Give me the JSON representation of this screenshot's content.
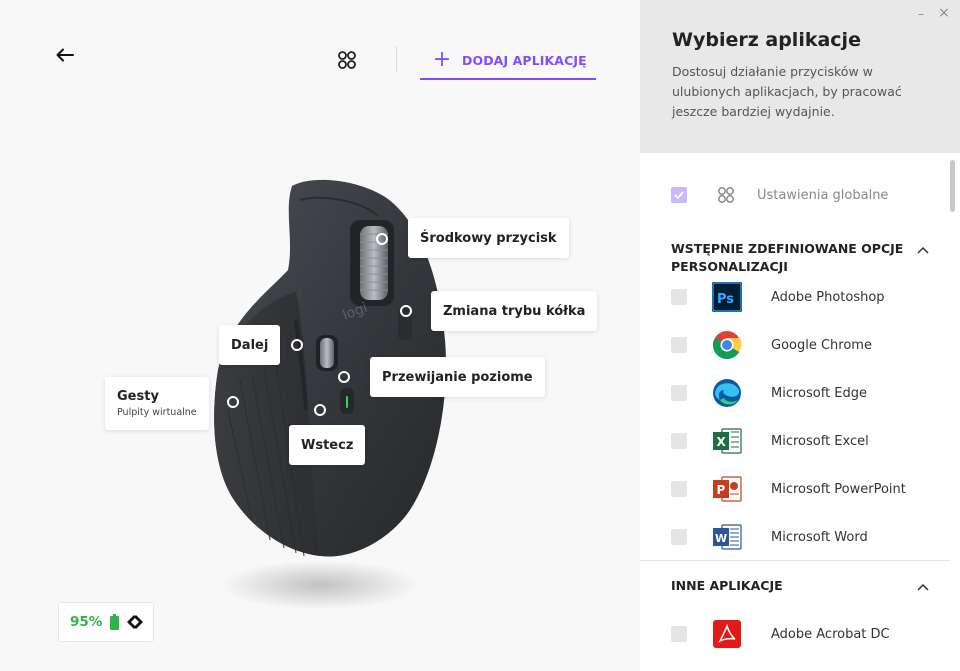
{
  "header": {
    "add_app_label": "DODAJ APLIKACJĘ"
  },
  "callouts": {
    "middle": "Środkowy przycisk",
    "wheel_mode": "Zmiana trybu kółka",
    "forward": "Dalej",
    "horizontal": "Przewijanie poziome",
    "gestures": "Gesty",
    "gestures_sub": "Pulpity wirtualne",
    "back": "Wstecz"
  },
  "mouse": {
    "brand": "logi"
  },
  "battery": {
    "percent": "95%",
    "color": "#2fb344"
  },
  "panel": {
    "title": "Wybierz aplikacje",
    "description": "Dostosuj działanie przycisków w ulubionych aplikacjach, by pracować jeszcze bardziej wydajnie.",
    "global_label": "Ustawienia globalne",
    "section_predefined": "WSTĘPNIE ZDEFINIOWANE OPCJE PERSONALIZACJI",
    "section_other": "INNE APLIKACJE",
    "apps": [
      {
        "name": "Adobe Photoshop",
        "icon": "photoshop-icon"
      },
      {
        "name": "Google Chrome",
        "icon": "chrome-icon"
      },
      {
        "name": "Microsoft Edge",
        "icon": "edge-icon"
      },
      {
        "name": "Microsoft Excel",
        "icon": "excel-icon"
      },
      {
        "name": "Microsoft PowerPoint",
        "icon": "powerpoint-icon"
      },
      {
        "name": "Microsoft Word",
        "icon": "word-icon"
      }
    ],
    "other_apps": [
      {
        "name": "Adobe Acrobat DC",
        "icon": "acrobat-icon"
      }
    ]
  },
  "colors": {
    "accent": "#814eff",
    "panel_header": "#e8e8e8"
  }
}
